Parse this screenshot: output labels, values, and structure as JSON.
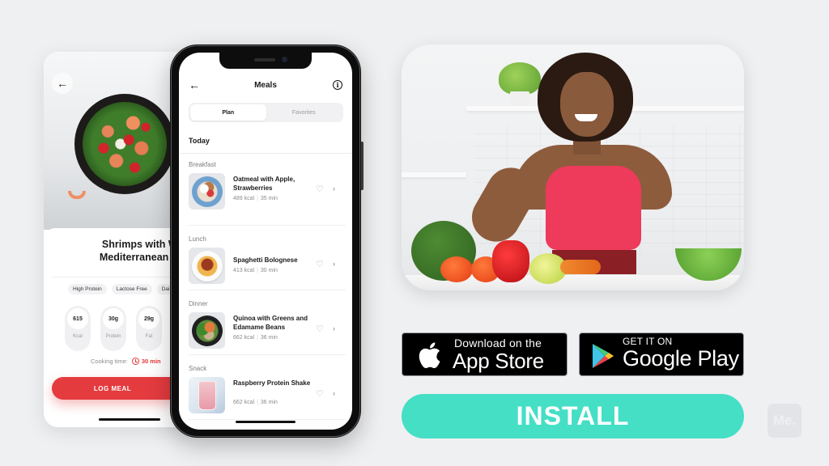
{
  "detail_screen": {
    "back_icon": "arrow-left-icon",
    "title": "Shrimps with Warm Mediterranean Salad",
    "title_line1": "Shrimps with Warm",
    "title_line2": "Mediterranean Salad",
    "tags": [
      "High Protein",
      "Lactose Free",
      "Dairy Free"
    ],
    "nutrition": [
      {
        "value": "615",
        "label": "Kcal"
      },
      {
        "value": "30g",
        "label": "Protein"
      },
      {
        "value": "29g",
        "label": "Fat"
      }
    ],
    "cooking_time_label": "Cooking time:",
    "cooking_time_value": "30 min",
    "log_button": "LOG MEAL"
  },
  "meals_screen": {
    "back_icon": "arrow-left-icon",
    "title": "Meals",
    "info_icon": "i",
    "tabs": [
      {
        "label": "Plan",
        "active": true
      },
      {
        "label": "Favorites",
        "active": false
      }
    ],
    "day_label": "Today",
    "sections": [
      {
        "label": "Breakfast",
        "name": "Oatmeal with Apple, Strawberries",
        "kcal": "489 kcal",
        "time": "35 min",
        "thumb": "oat"
      },
      {
        "label": "Lunch",
        "name": "Spaghetti Bolognese",
        "kcal": "413 kcal",
        "time": "30 min",
        "thumb": "spag"
      },
      {
        "label": "Dinner",
        "name": "Quinoa with Greens and Edamame Beans",
        "kcal": "662 kcal",
        "time": "36 min",
        "thumb": "quinoa"
      },
      {
        "label": "Snack",
        "name": "Raspberry Protein Shake",
        "kcal": "662 kcal",
        "time": "36 min",
        "thumb": "shake"
      }
    ],
    "heart_glyph": "♡",
    "chevron_glyph": "›",
    "separator": "|"
  },
  "store_badges": {
    "apple": {
      "small": "Download on the",
      "big": "App Store"
    },
    "google": {
      "small": "GET IT ON",
      "big": "Google Play"
    }
  },
  "install_button": "INSTALL",
  "watermark": "Me.",
  "colors": {
    "accent_red": "#e43b3f",
    "install_teal": "#44dfc5",
    "background": "#eff0f2"
  }
}
